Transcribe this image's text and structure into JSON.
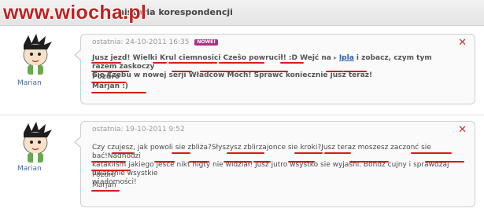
{
  "watermark": "www.wiocha.pl",
  "header": {
    "title": "historia korespondencji"
  },
  "messages": [
    {
      "author": "Marian",
      "meta": "ostatnia: 24-10-2011 16:35",
      "badge": "NOWE!",
      "line1_a": "Jusz jezd! Wielki Krul ciemnosici Czeŝo powrucił! :D Wejć na ",
      "line1_link": "Ipla",
      "line1_b": " i zobacz, czym tym razem zaskoczy",
      "line2": "Cie Czebu w nowej serji Władców Móch! Sprawć koniecznie jusz teraz!",
      "sig1": "Pozdro",
      "sig2": "Marjan :)"
    },
    {
      "author": "Marian",
      "meta": "ostatnia: 19-10-2011 9:52",
      "line1": "Czy czujesz, jak powoli sie zbliża?Słyszysz zblirzajonce sie kroki?Jusz teraz moszesz zaczonć sie bać!Nadhodzi",
      "line2": "kataklism jakiego jesce nikt nigty nie widział! Jusz jutro wsystko sie wyjaśni. Bondz cujny i sprawdzaj uwasznie wsystkie",
      "line3": "wiadomości!",
      "sig1": "Pozdro",
      "sig2": "Marjan"
    }
  ]
}
